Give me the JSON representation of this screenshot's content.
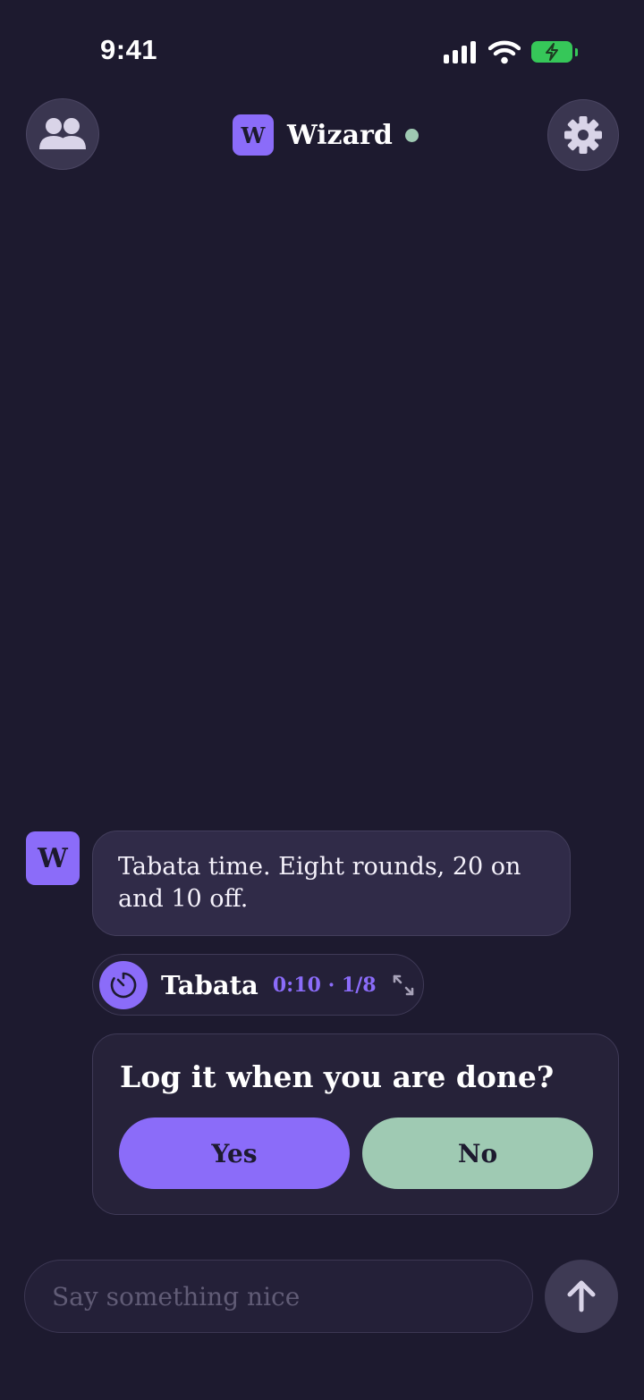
{
  "status_bar": {
    "time": "9:41",
    "icons": [
      "cellular-signal-icon",
      "wifi-icon",
      "battery-charging-icon"
    ]
  },
  "header": {
    "left_button_icon": "people-icon",
    "avatar_letter": "W",
    "title": "Wizard",
    "status": "online",
    "right_button_icon": "gear-icon"
  },
  "conversation": {
    "assistant_avatar_letter": "W",
    "message": "Tabata time. Eight rounds, 20 on and 10 off.",
    "timer": {
      "icon": "timer-icon",
      "label": "Tabata",
      "meta": "0:10 · 1/8",
      "expand_icon": "expand-arrows-icon"
    },
    "prompt": {
      "question": "Log it when you are done?",
      "yes_label": "Yes",
      "no_label": "No"
    }
  },
  "composer": {
    "placeholder": "Say something nice",
    "value": "",
    "send_icon": "arrow-up-icon"
  },
  "colors": {
    "background": "#1d1a2f",
    "accent_purple": "#8b6cf9",
    "accent_green": "#9fcab3",
    "bubble": "#302b48"
  }
}
